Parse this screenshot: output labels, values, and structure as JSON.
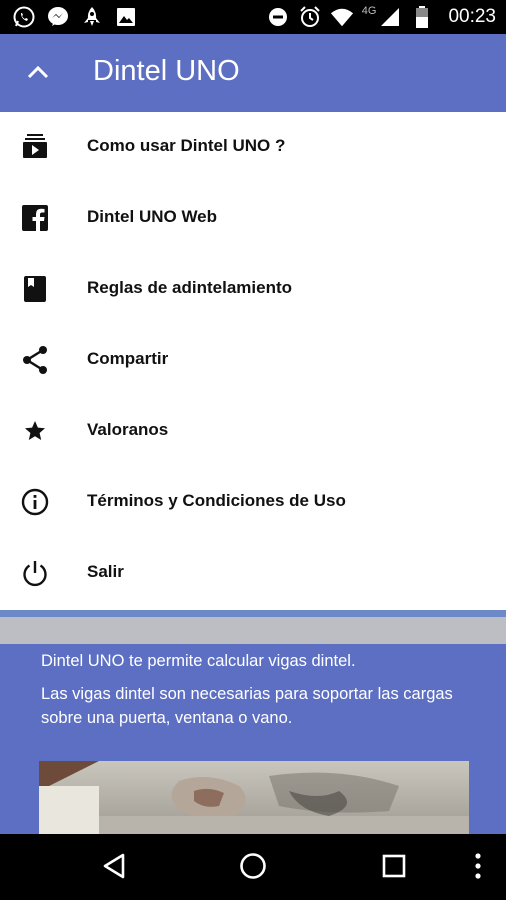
{
  "status_bar": {
    "time": "00:23",
    "network": "4G",
    "left_icons": [
      "whatsapp-icon",
      "messenger-icon",
      "rocket-icon",
      "image-icon"
    ],
    "right_icons": [
      "do-not-disturb-icon",
      "alarm-icon",
      "wifi-icon",
      "signal-icon",
      "battery-icon"
    ]
  },
  "app_bar": {
    "title": "Dintel UNO",
    "background": "#5d6fc2"
  },
  "menu": {
    "items": [
      {
        "label": "Como usar Dintel UNO ?",
        "icon": "video-library-icon"
      },
      {
        "label": "Dintel UNO Web",
        "icon": "facebook-icon"
      },
      {
        "label": "Reglas de adintelamiento",
        "icon": "book-icon"
      },
      {
        "label": "Compartir",
        "icon": "share-icon"
      },
      {
        "label": "Valoranos",
        "icon": "star-icon"
      },
      {
        "label": "Términos y Condiciones de Uso",
        "icon": "info-icon"
      },
      {
        "label": "Salir",
        "icon": "power-icon"
      }
    ]
  },
  "content": {
    "intro": "Dintel UNO te permite calcular vigas dintel.",
    "description": "Las vigas dintel  son necesarias para soportar las cargas sobre una puerta, ventana o vano."
  },
  "nav_bar": {
    "buttons": [
      "back-icon",
      "home-icon",
      "recents-icon",
      "overflow-menu-icon"
    ]
  }
}
